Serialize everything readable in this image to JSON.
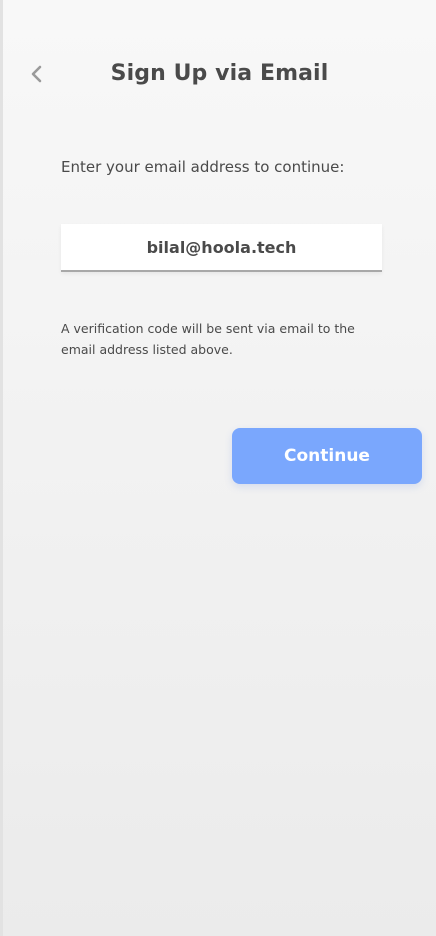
{
  "header": {
    "title": "Sign Up via Email",
    "back_icon": "chevron-left-icon"
  },
  "form": {
    "prompt": "Enter your email address to continue:",
    "email_value": "bilal@hoola.tech",
    "note": "A verification code will be sent via email to the email address listed above.",
    "continue_label": "Continue"
  },
  "colors": {
    "accent": "#7aa7fd",
    "text": "#4a4a4a",
    "background": "#f4f4f4"
  }
}
